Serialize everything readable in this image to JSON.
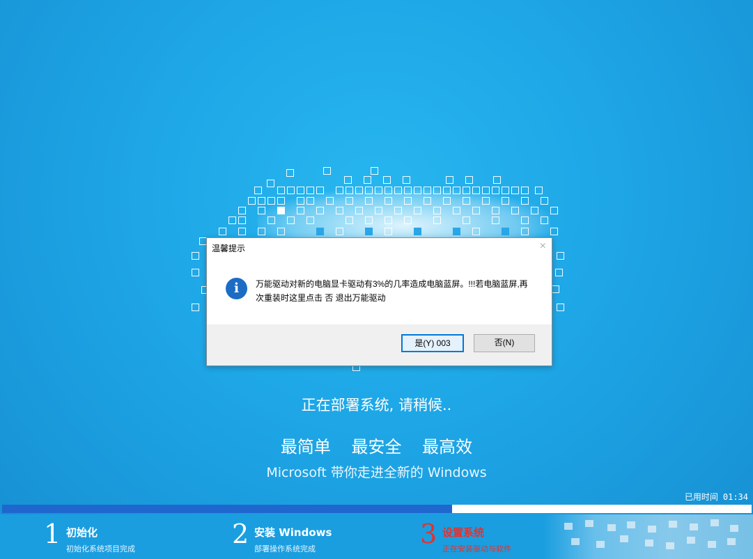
{
  "dialog": {
    "title": "温馨提示",
    "close_label": "×",
    "message": "万能驱动对新的电脑显卡驱动有3%的几率造成电脑蓝屏。!!!若电脑蓝屏,再次重装时这里点击 否 退出万能驱动",
    "icon": "info-icon",
    "yes_label": "是(Y) 003",
    "no_label": "否(N)"
  },
  "status": "正在部署系统, 请稍候..",
  "slogans": [
    "最简单",
    "最安全",
    "最高效"
  ],
  "tagline": "Microsoft 带你走进全新的 Windows",
  "elapsed": {
    "label": "已用时间",
    "value": "01:34"
  },
  "progress": {
    "fraction": 0.6
  },
  "steps": [
    {
      "num": "1",
      "title": "初始化",
      "subtitle": "初始化系统项目完成",
      "active": false
    },
    {
      "num": "2",
      "title": "安装 Windows",
      "subtitle": "部署操作系统完成",
      "active": false
    },
    {
      "num": "3",
      "title": "设置系统",
      "subtitle": "正在安装驱动与软件",
      "active": true
    }
  ],
  "colors": {
    "background": "#1ea6e6",
    "progress_fill": "#1f67cf",
    "active_step": "#e8302b",
    "dialog_primary_border": "#0078d7",
    "info_icon": "#1c6cc4"
  }
}
